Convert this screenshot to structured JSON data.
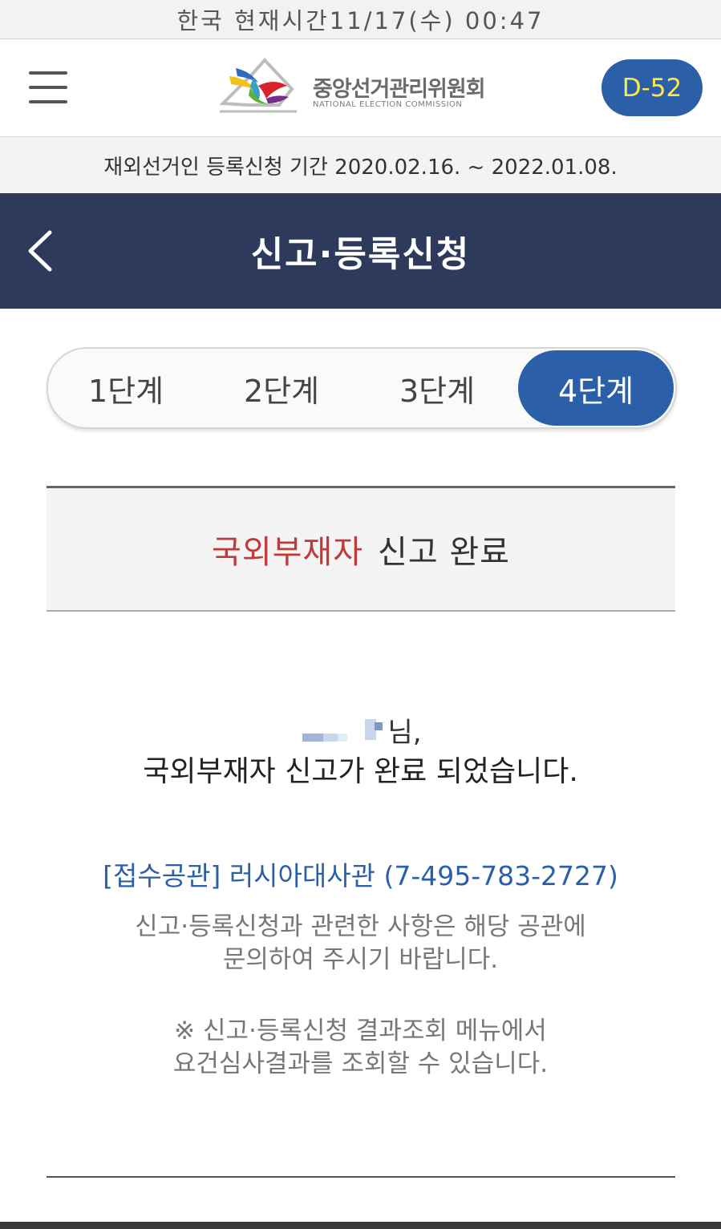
{
  "status_bar": {
    "text": "한국 현재시간11/17(수) 00:47"
  },
  "header": {
    "logo_title": "중앙선거관리위원회",
    "logo_subtitle": "NATIONAL ELECTION COMMISSION",
    "dday_badge": "D-52"
  },
  "period_banner": "재외선거인 등록신청 기간 2020.02.16. ~ 2022.01.08.",
  "page": {
    "title": "신고·등록신청"
  },
  "steps": [
    {
      "label": "1단계",
      "active": false
    },
    {
      "label": "2단계",
      "active": false
    },
    {
      "label": "3단계",
      "active": false
    },
    {
      "label": "4단계",
      "active": true
    }
  ],
  "result": {
    "highlight": "국외부재자",
    "rest": "신고 완료"
  },
  "message": {
    "name_suffix": "님,",
    "complete_text": "국외부재자 신고가 완료 되었습니다."
  },
  "office": {
    "label": "[접수공관]",
    "name_phone": "러시아대사관 (7-495-783-2727)"
  },
  "notice_lines": [
    "신고·등록신청과 관련한 사항은 해당 공관에",
    "문의하여 주시기 바랍니다."
  ],
  "notice2_lines": [
    "※ 신고·등록신청 결과조회 메뉴에서",
    "요건심사결과를 조회할 수 있습니다."
  ],
  "colors": {
    "navy": "#2e3a5c",
    "accent_blue": "#2b5fa8",
    "dday_text": "#ffe84a",
    "highlight_red": "#c0393b"
  }
}
